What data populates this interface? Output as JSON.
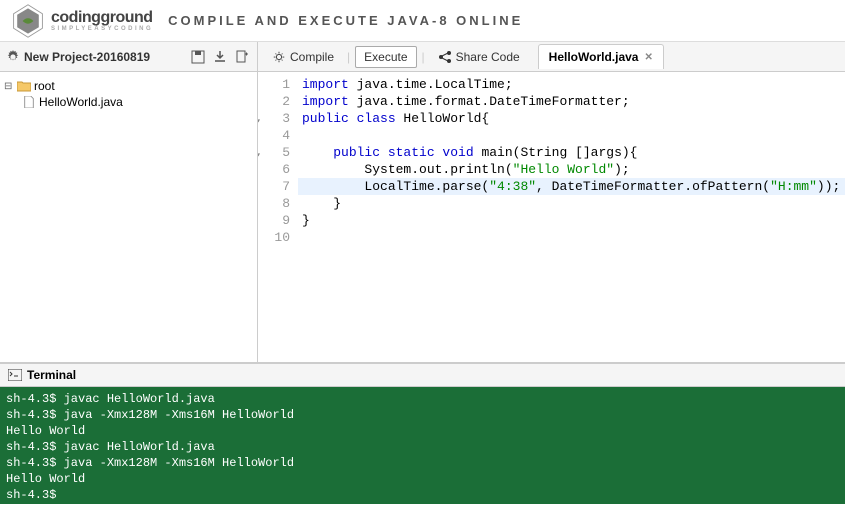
{
  "header": {
    "brand_bold": "coding",
    "brand_light": "ground",
    "brand_sub": "SIMPLYEASYCODING",
    "title": "COMPILE AND EXECUTE JAVA-8 ONLINE"
  },
  "sidebar": {
    "project_name": "New Project-20160819",
    "root_label": "root",
    "file_label": "HelloWorld.java"
  },
  "toolbar": {
    "compile": "Compile",
    "execute": "Execute",
    "share": "Share Code",
    "tab_name": "HelloWorld.java"
  },
  "code": {
    "lines": [
      {
        "n": "1",
        "fold": "",
        "tokens": [
          {
            "t": "import ",
            "c": "kw"
          },
          {
            "t": "java.time.LocalTime;",
            "c": ""
          }
        ]
      },
      {
        "n": "2",
        "fold": "",
        "tokens": [
          {
            "t": "import ",
            "c": "kw"
          },
          {
            "t": "java.time.format.DateTimeFormatter;",
            "c": ""
          }
        ]
      },
      {
        "n": "3",
        "fold": "▾",
        "tokens": [
          {
            "t": "public class ",
            "c": "kw"
          },
          {
            "t": "HelloWorld{",
            "c": ""
          }
        ]
      },
      {
        "n": "4",
        "fold": "",
        "tokens": [
          {
            "t": "",
            "c": ""
          }
        ]
      },
      {
        "n": "5",
        "fold": "▾",
        "tokens": [
          {
            "t": "    ",
            "c": ""
          },
          {
            "t": "public static void ",
            "c": "kw"
          },
          {
            "t": "main(String []args){",
            "c": ""
          }
        ]
      },
      {
        "n": "6",
        "fold": "",
        "tokens": [
          {
            "t": "        System.out.println(",
            "c": ""
          },
          {
            "t": "\"Hello World\"",
            "c": "str"
          },
          {
            "t": ");",
            "c": ""
          }
        ]
      },
      {
        "n": "7",
        "fold": "",
        "hl": true,
        "tokens": [
          {
            "t": "        LocalTime.parse(",
            "c": ""
          },
          {
            "t": "\"4:38\"",
            "c": "str"
          },
          {
            "t": ", DateTimeFormatter.ofPattern(",
            "c": ""
          },
          {
            "t": "\"H:mm\"",
            "c": "str"
          },
          {
            "t": "));",
            "c": ""
          }
        ]
      },
      {
        "n": "8",
        "fold": "",
        "tokens": [
          {
            "t": "    }",
            "c": ""
          }
        ]
      },
      {
        "n": "9",
        "fold": "",
        "tokens": [
          {
            "t": "}",
            "c": ""
          }
        ]
      },
      {
        "n": "10",
        "fold": "",
        "tokens": [
          {
            "t": "",
            "c": ""
          }
        ]
      }
    ]
  },
  "terminal": {
    "title": "Terminal",
    "lines": [
      "sh-4.3$ javac HelloWorld.java",
      "sh-4.3$ java -Xmx128M -Xms16M HelloWorld",
      "Hello World",
      "sh-4.3$ javac HelloWorld.java",
      "sh-4.3$ java -Xmx128M -Xms16M HelloWorld",
      "Hello World",
      "sh-4.3$ "
    ]
  }
}
